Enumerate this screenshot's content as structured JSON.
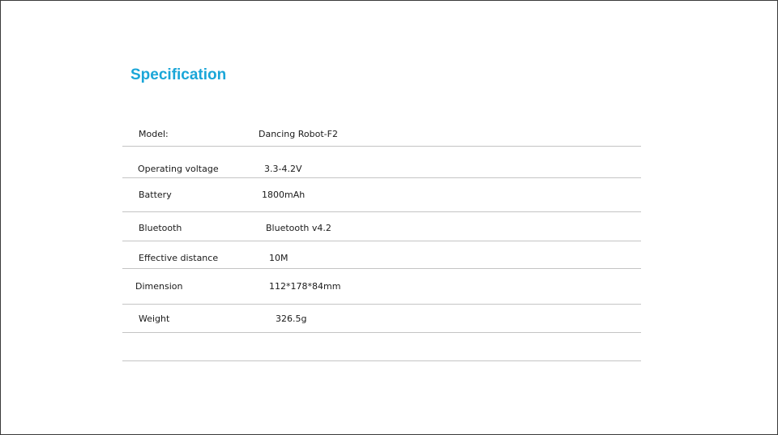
{
  "title": "Specification",
  "specs": [
    {
      "label": "Model:",
      "value": "Dancing Robot-F2"
    },
    {
      "label": "Operating voltage",
      "value": "3.3-4.2V"
    },
    {
      "label": "Battery",
      "value": "1800mAh"
    },
    {
      "label": "Bluetooth",
      "value": "Bluetooth v4.2"
    },
    {
      "label": "Effective distance",
      "value": "10M"
    },
    {
      "label": "Dimension",
      "value": "112*178*84mm"
    },
    {
      "label": "Weight",
      "value": "326.5g"
    }
  ]
}
